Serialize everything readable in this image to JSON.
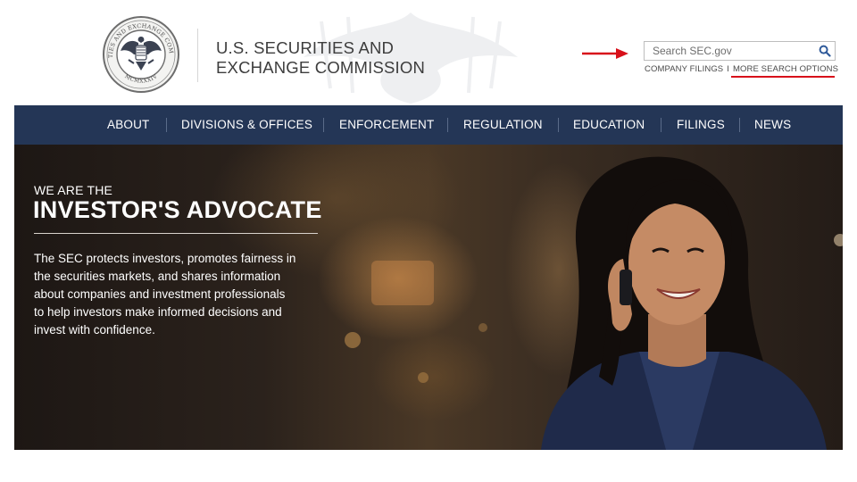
{
  "header": {
    "agency_line1": "U.S. SECURITIES AND",
    "agency_line2": "EXCHANGE COMMISSION",
    "seal_text_top": "SECURITIES AND EXCHANGE COMMISSION",
    "seal_text_bottom": "MCMXXXIV",
    "search": {
      "placeholder": "Search SEC.gov",
      "icon": "search-icon"
    },
    "links": {
      "company_filings": "COMPANY FILINGS",
      "separator": "I",
      "more_search_options": "MORE SEARCH OPTIONS"
    },
    "annotation_color": "#d8101a"
  },
  "nav": {
    "background": "#243656",
    "items": [
      {
        "label": "ABOUT"
      },
      {
        "label": "DIVISIONS & OFFICES"
      },
      {
        "label": "ENFORCEMENT"
      },
      {
        "label": "REGULATION"
      },
      {
        "label": "EDUCATION"
      },
      {
        "label": "FILINGS"
      },
      {
        "label": "NEWS"
      }
    ]
  },
  "hero": {
    "kicker": "WE ARE THE",
    "title": "INVESTOR'S ADVOCATE",
    "body_lines": [
      "The SEC protects investors, promotes fairness in",
      "the securities markets, and shares information",
      "about companies and investment professionals",
      "to help investors make informed decisions and",
      "invest with confidence."
    ]
  }
}
